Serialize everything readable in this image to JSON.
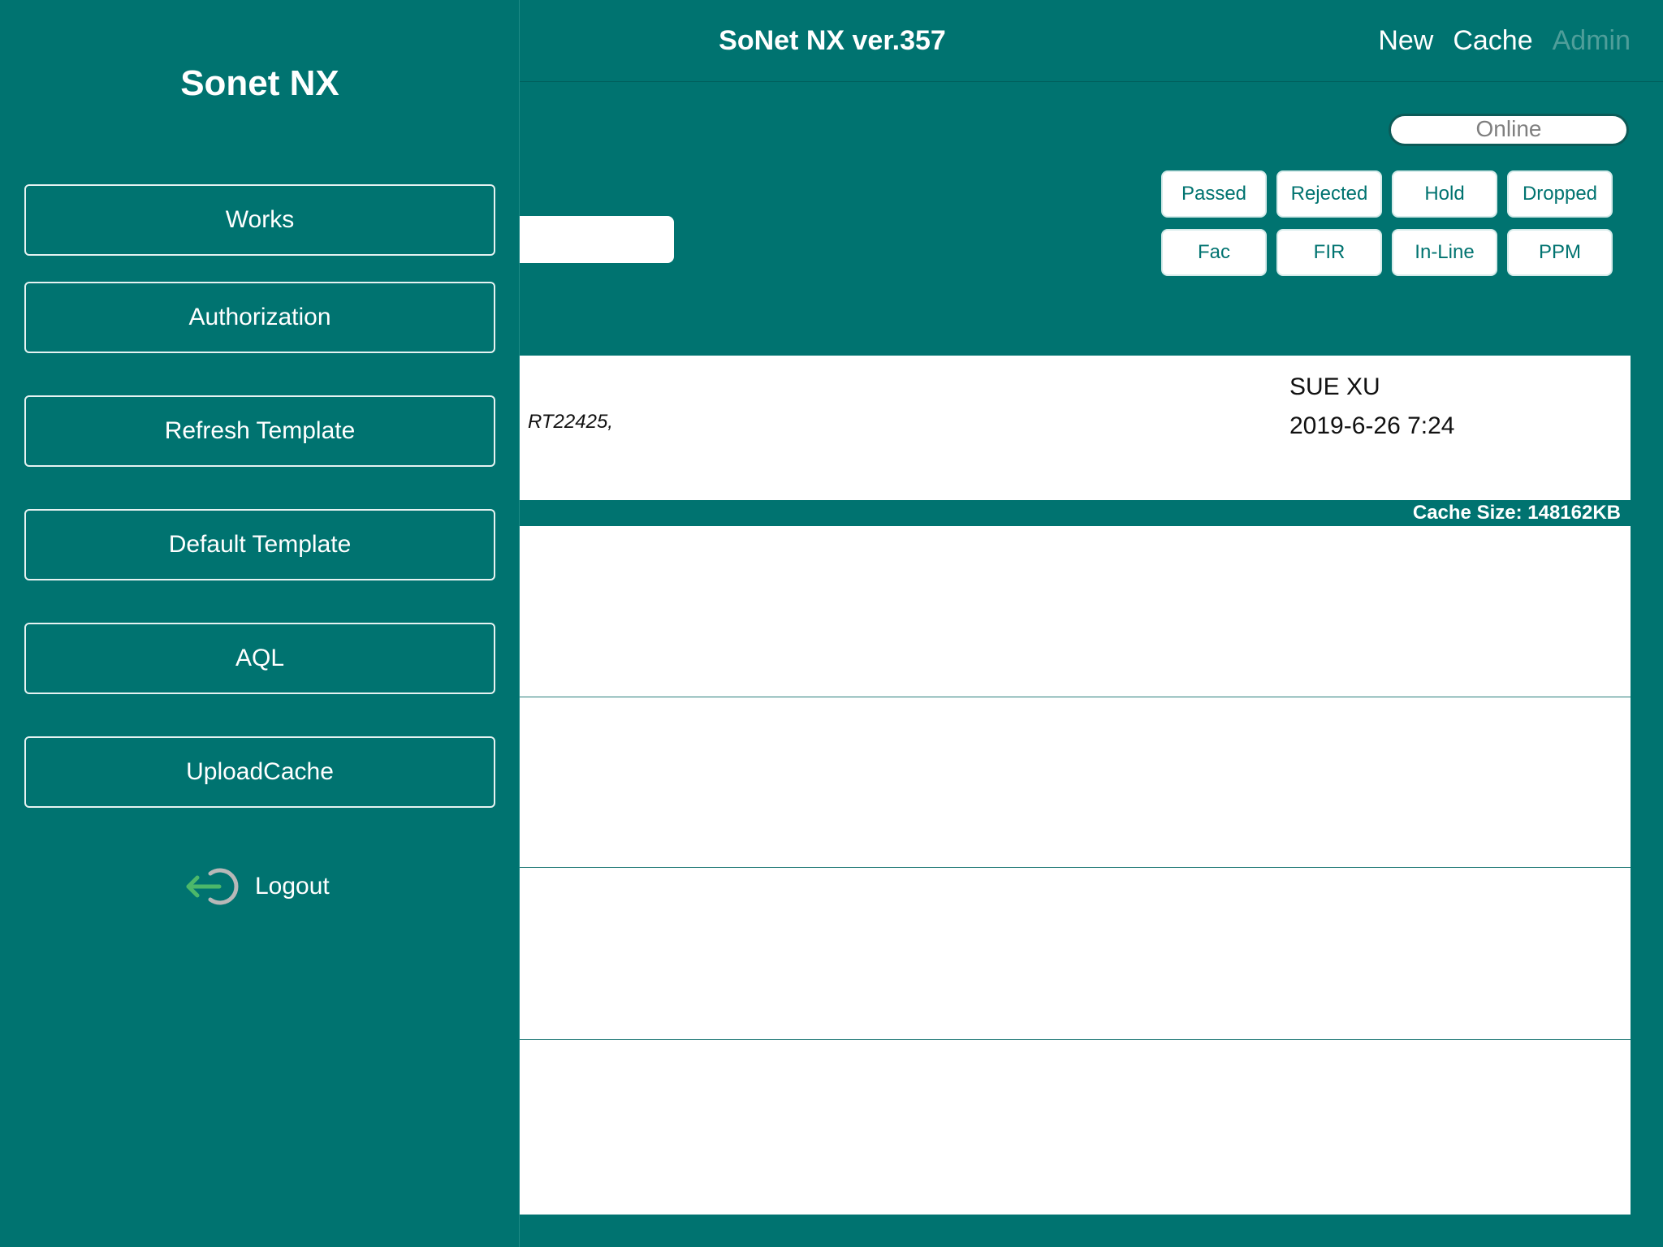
{
  "navbar": {
    "title": "SoNet NX ver.357",
    "new_label": "New",
    "cache_label": "Cache",
    "admin_label": "Admin"
  },
  "status": {
    "online_label": "Online"
  },
  "filters": {
    "row1": [
      "Passed",
      "Rejected",
      "Hold",
      "Dropped"
    ],
    "row2": [
      "Fac",
      "FIR",
      "In-Line",
      "PPM"
    ]
  },
  "record": {
    "ref": "RT22425,",
    "user": "SUE XU",
    "date": "2019-6-26 7:24"
  },
  "cache": {
    "size_text": "Cache Size: 148162KB"
  },
  "drawer": {
    "title": "Sonet NX",
    "items": [
      {
        "label": "Works"
      },
      {
        "label": "Authorization"
      },
      {
        "label": "Refresh Template"
      },
      {
        "label": "Default Template"
      },
      {
        "label": "AQL"
      },
      {
        "label": "UploadCache"
      }
    ],
    "logout_label": "Logout",
    "logout_icon": "logout-icon"
  },
  "colors": {
    "primary": "#007370",
    "admin_disabled": "#4f9e9a",
    "logout_arrow": "#4cb86a",
    "logout_ring": "#b8b8b8"
  }
}
